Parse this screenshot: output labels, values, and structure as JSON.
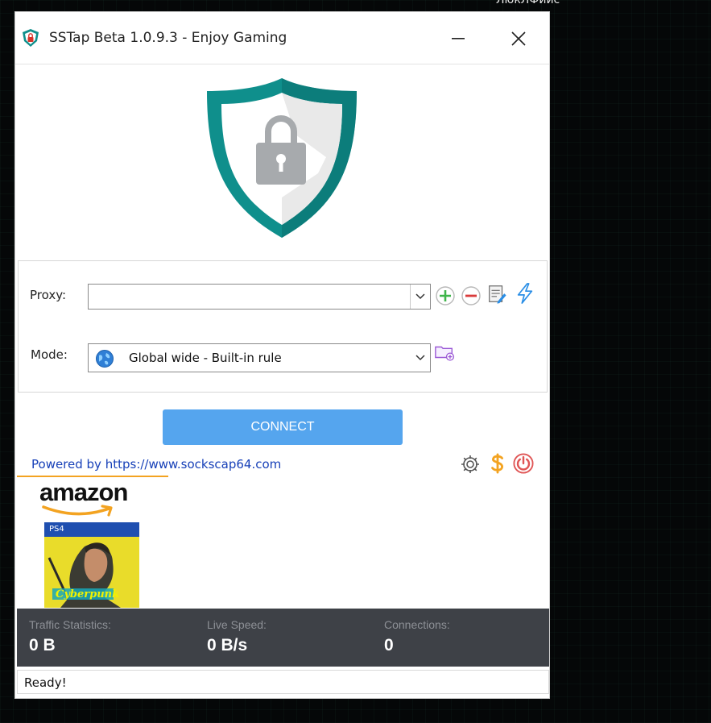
{
  "background_text": "ЛюкЛФиис",
  "window": {
    "title": "SSTap Beta 1.0.9.3 - Enjoy Gaming"
  },
  "form": {
    "proxy_label": "Proxy:",
    "proxy_value": "",
    "mode_label": "Mode:",
    "mode_value": "Global wide - Built-in rule"
  },
  "connect_label": "CONNECT",
  "powered_text": "Powered by https://www.sockscap64.com",
  "ad": {
    "brand": "amazon",
    "platform": "PS4",
    "game_title": "Cyberpunk"
  },
  "stats": [
    {
      "label": "Traffic Statistics:",
      "value": "0 B"
    },
    {
      "label": "Live Speed:",
      "value": "0 B/s"
    },
    {
      "label": "Connections:",
      "value": "0"
    }
  ],
  "status_text": "Ready!",
  "colors": {
    "accent_teal": "#0f8f8c",
    "connect_blue": "#55a5ee",
    "link_blue": "#1740b8",
    "stats_bg": "#3e4147",
    "amazon_orange": "#f3a321"
  },
  "icons": [
    "shield-lock-icon",
    "minimize-icon",
    "close-icon",
    "add-icon",
    "remove-icon",
    "edit-icon",
    "lightning-icon",
    "globe-icon",
    "folder-add-icon",
    "gear-icon",
    "dollar-icon",
    "power-icon"
  ]
}
